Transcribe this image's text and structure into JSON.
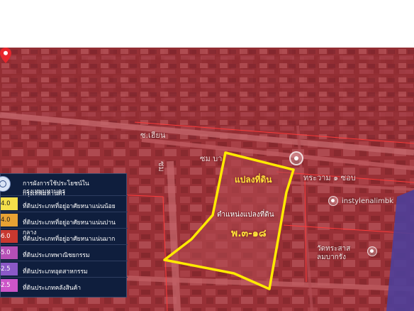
{
  "map": {
    "road_labels": [
      "ซ.เฮียน",
      "ซม",
      "ทระวาม ๑ ซอบ",
      "ซม บา"
    ],
    "place_labels": [
      "instylenalimbk",
      "วัดทระสาส",
      "ลมบากรัง"
    ],
    "plot_title": "แปลงที่ดิน",
    "pin_label": "ตำแหน่งแปลงที่ดิน",
    "plot_code": "พ.๓-๑๘",
    "icons": [
      "location-pin-icon",
      "poi-icon"
    ],
    "colors": {
      "overlay": "#a8333a",
      "boundary": "#ffea00",
      "pin": "#e8252c"
    }
  },
  "legend": {
    "title_line1": "การผังการใช้ประโยชน์ในกรุงเทพมหานคร",
    "title_line2": "กรุงเทพมหานคร",
    "rows": [
      {
        "far": "-4.0",
        "label": "ที่ดินประเภทที่อยู่อาศัยหนาแน่นน้อย",
        "color": "#f4e04a"
      },
      {
        "far": "-4.0",
        "label": "ที่ดินประเภทที่อยู่อาศัยหนาแน่นปานกลาง",
        "color": "#e8a233"
      },
      {
        "far": "-6.0",
        "label": "ที่ดินประเภทที่อยู่อาศัยหนาแน่นมาก",
        "color": "#c8382f"
      },
      {
        "far": "-5.0",
        "label": "ที่ดินประเภทพาณิชยกรรม",
        "color": "#b54fb6"
      },
      {
        "far": "-2.5",
        "label": "ที่ดินประเภทอุตสาหกรรม",
        "color": "#8b58c7"
      },
      {
        "far": "-2.5",
        "label": "ที่ดินประเภทคลังสินค้า",
        "color": "#cc55c8"
      }
    ]
  }
}
